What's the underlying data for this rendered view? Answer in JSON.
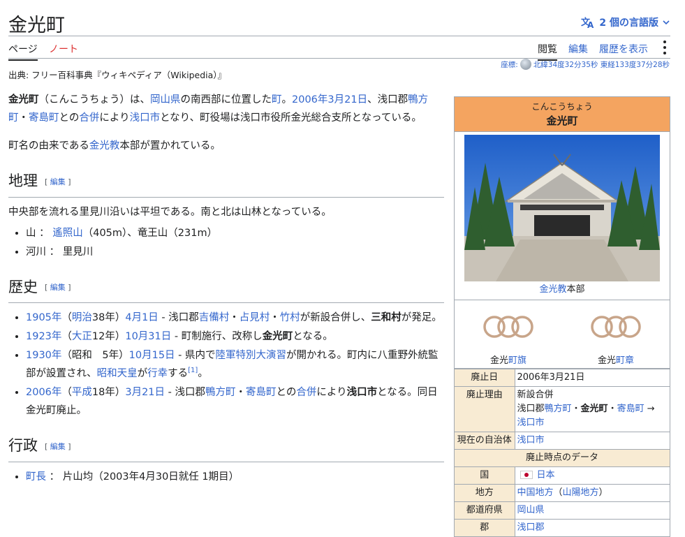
{
  "header": {
    "title": "金光町",
    "language_button": "2 個の言語版",
    "tabs": {
      "page": "ページ",
      "note": "ノート",
      "read": "閲覧",
      "edit": "編集",
      "history": "履歴を表示"
    },
    "coords_label": "座標:",
    "coords": "北緯34度32分35秒 東経133度37分28秒",
    "source": "出典: フリー百科事典『ウィキペディア（Wikipedia）』"
  },
  "intro": {
    "p1": {
      "bold": "金光町",
      "t1": "（こんこうちょう）は、",
      "l1": "岡山県",
      "t2": "の南西部に位置した",
      "l2": "町",
      "t3": "。",
      "l3": "2006年3月21日",
      "t4": "、浅口郡",
      "l4": "鴨方町",
      "t5": "・",
      "l5": "寄島町",
      "t6": "との",
      "l6": "合併",
      "t7": "により",
      "l7": "浅口市",
      "t8": "となり、町役場は浅口市役所金光総合支所となっている。"
    },
    "p2": {
      "t1": "町名の由来である",
      "l1": "金光教",
      "t2": "本部が置かれている。"
    }
  },
  "sections": {
    "edit_label": "編集",
    "geo": {
      "title": "地理",
      "text": "中央部を流れる里見川沿いは平坦である。南と北は山林となっている。",
      "item1": {
        "t1": "山 ：",
        "l1": "遙照山",
        "t2": "（405m）、竜王山（231m）"
      },
      "item2": "河川 ： 里見川"
    },
    "history": {
      "title": "歴史",
      "i1": {
        "l1": "1905年",
        "t1": "（",
        "l2": "明治",
        "t2": "38年）",
        "l3": "4月1日",
        "t3": " - 浅口郡",
        "l4": "吉備村",
        "t4": "・",
        "l5": "占見村",
        "t5": "・",
        "l6": "竹村",
        "t6": "が新設合併し、",
        "b1": "三和村",
        "t7": "が発足。"
      },
      "i2": {
        "l1": "1923年",
        "t1": "（",
        "l2": "大正",
        "t2": "12年）",
        "l3": "10月31日",
        "t3": " - 町制施行、改称し",
        "b1": "金光町",
        "t4": "となる。"
      },
      "i3": {
        "l1": "1930年",
        "t1": "（昭和　5年）",
        "l2": "10月15日",
        "t2": " - 県内で",
        "l3": "陸軍特別大演習",
        "t3": "が開かれる。町内に八重野外統監部が設置され、",
        "l4": "昭和天皇",
        "t4": "が",
        "l5": "行幸",
        "t5": "する",
        "sup": "[1]",
        "t6": "。"
      },
      "i4": {
        "l1": "2006年",
        "t1": "（",
        "l2": "平成",
        "t2": "18年）",
        "l3": "3月21日",
        "t3": " - 浅口郡",
        "l4": "鴨方町",
        "t4": "・",
        "l5": "寄島町",
        "t5": "との",
        "l6": "合併",
        "t6": "により",
        "b1": "浅口市",
        "t7": "となる。同日金光町廃止。"
      }
    },
    "admin": {
      "title": "行政",
      "i1": {
        "l1": "町長",
        "t1": " ： 片山均（2003年4月30日就任 1期目）"
      }
    }
  },
  "infobox": {
    "reading": "こんこうちょう",
    "name": "金光町",
    "photo_caption_link": "金光教",
    "photo_caption_text": "本部",
    "flag_caption_text": "金光",
    "flag_caption_link": "町旗",
    "emblem_caption_text": "金光",
    "emblem_caption_link": "町章",
    "rows": {
      "abolished_date_k": "廃止日",
      "abolished_date_v": "2006年3月21日",
      "reason_k": "廃止理由",
      "reason_v1": "新設合併",
      "reason_v2_t1": "浅口郡",
      "reason_v2_l1": "鴨方町",
      "reason_v2_t2": "・",
      "reason_v2_b1": "金光町",
      "reason_v2_t3": "・",
      "reason_v2_l2": "寄島町",
      "reason_v2_t4": " →",
      "reason_v3": "浅口市",
      "current_k": "現在の自治体",
      "current_v": "浅口市",
      "subhead": "廃止時点のデータ",
      "country_k": "国",
      "country_v": "日本",
      "region_k": "地方",
      "region_v1": "中国地方",
      "region_v2": "（",
      "region_v3": "山陽地方",
      "region_v4": "）",
      "pref_k": "都道府県",
      "pref_v": "岡山県",
      "county_k": "郡",
      "county_v": "浅口郡"
    }
  },
  "colors": {
    "link": "#3366cc",
    "infobox_header": "#f4a460",
    "infobox_key": "#f8ebd3",
    "emblem": "#c8a58a"
  }
}
